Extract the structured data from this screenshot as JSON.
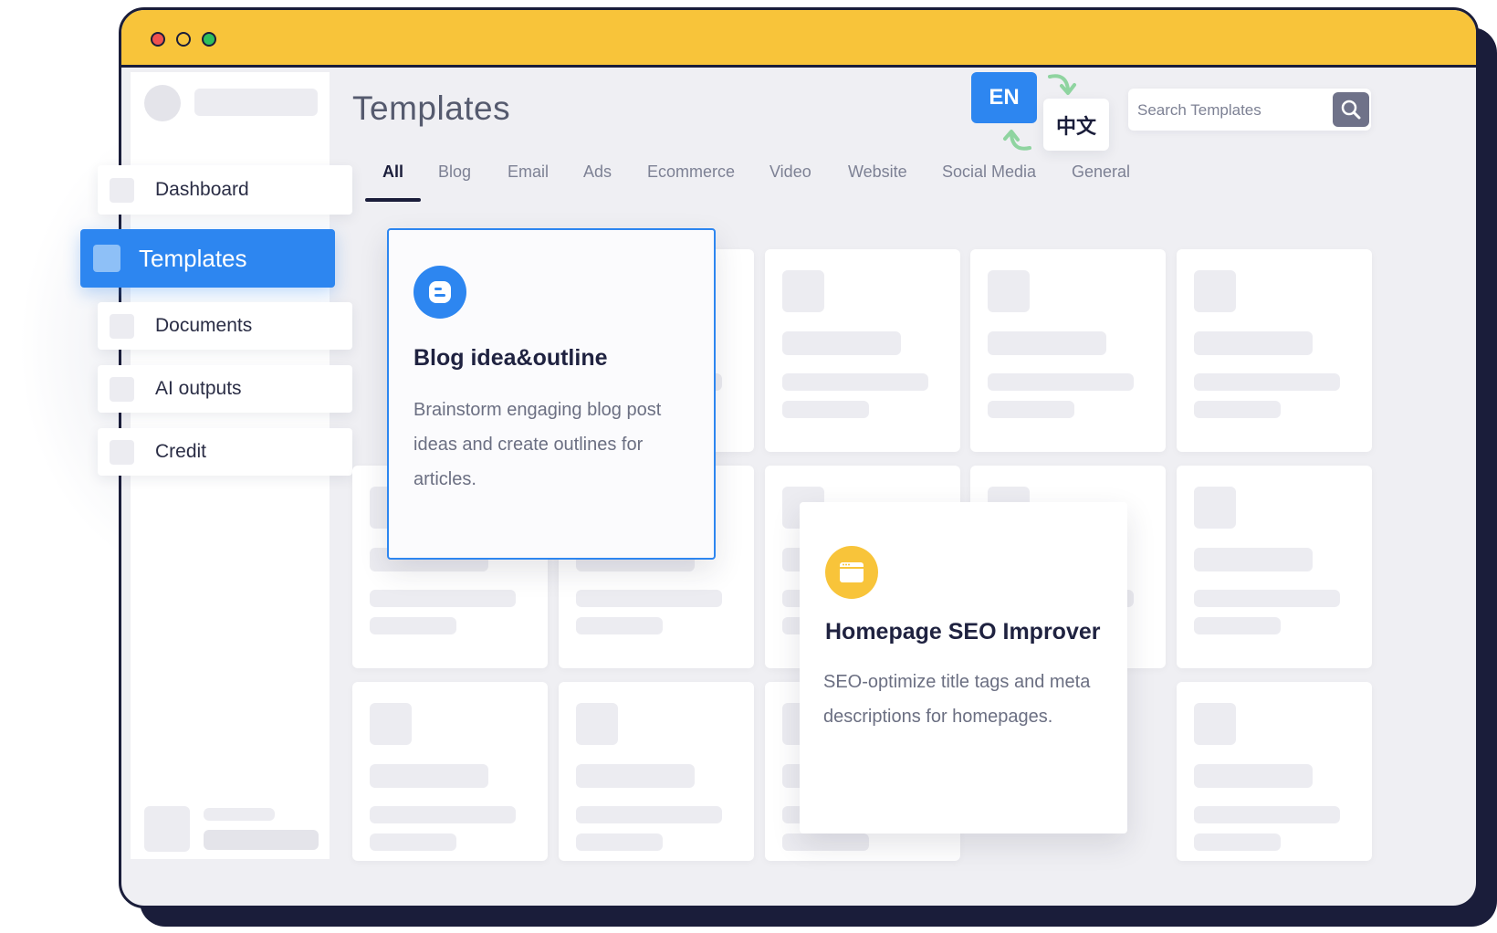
{
  "window": {
    "controls": [
      "close",
      "minimize",
      "maximize"
    ],
    "colors": {
      "titlebar": "#f8c43a",
      "frame": "#1a1d3a",
      "accent": "#2d86f0"
    }
  },
  "sidebar": {
    "items": [
      {
        "label": "Dashboard",
        "active": false
      },
      {
        "label": "Templates",
        "active": true
      },
      {
        "label": "Documents",
        "active": false
      },
      {
        "label": "AI outputs",
        "active": false
      },
      {
        "label": "Credit",
        "active": false
      }
    ]
  },
  "header": {
    "title": "Templates",
    "language": {
      "primary": "EN",
      "secondary": "中文"
    },
    "search": {
      "placeholder": "Search Templates",
      "icon": "search-icon"
    }
  },
  "tabs": [
    {
      "label": "All",
      "active": true
    },
    {
      "label": "Blog"
    },
    {
      "label": "Email"
    },
    {
      "label": "Ads"
    },
    {
      "label": "Ecommerce"
    },
    {
      "label": "Video"
    },
    {
      "label": "Website"
    },
    {
      "label": "Social Media"
    },
    {
      "label": "General"
    }
  ],
  "featured_cards": [
    {
      "title": "Blog idea&outline",
      "description": "Brainstorm engaging blog post ideas and create outlines for articles.",
      "icon": "blogger-icon",
      "icon_color": "#2d86f0"
    },
    {
      "title": "Homepage SEO Improver",
      "description": "SEO-optimize title tags and meta descriptions for homepages.",
      "icon": "browser-window-icon",
      "icon_color": "#f8c43a"
    }
  ]
}
